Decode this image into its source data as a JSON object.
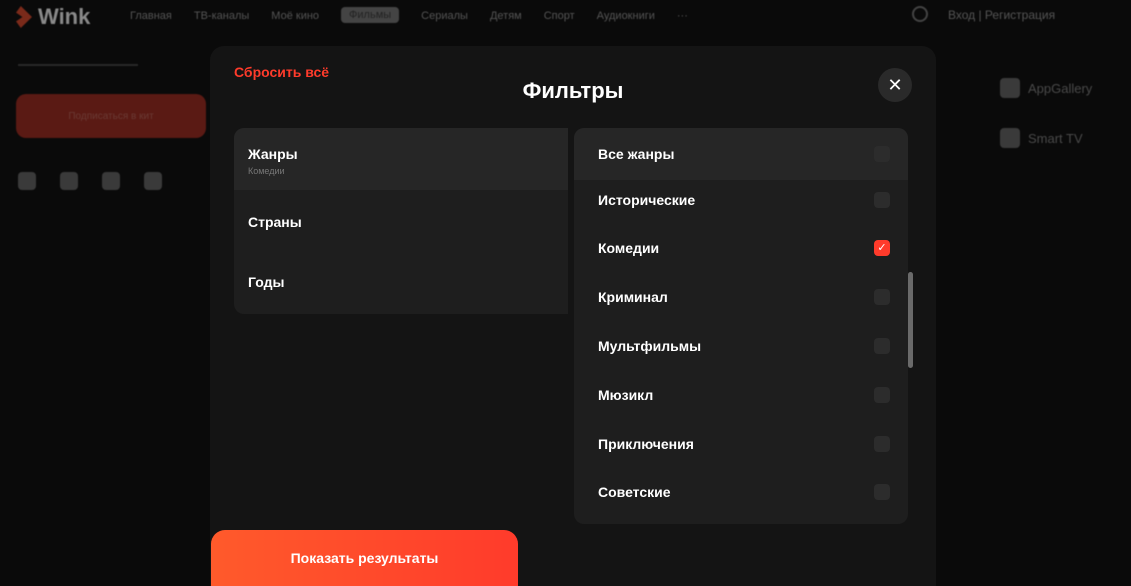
{
  "background": {
    "logo": "Wink",
    "nav": [
      "Главная",
      "ТВ-каналы",
      "Моё кино",
      "Фильмы",
      "Сериалы",
      "Детям",
      "Спорт",
      "Аудиокниги",
      "···"
    ],
    "login": "Вход | Регистрация",
    "left_button": "Подписаться в кит",
    "apps": [
      "AppGallery",
      "Smart TV"
    ]
  },
  "modal": {
    "reset_label": "Сбросить всё",
    "title": "Фильтры",
    "close_icon": "close-icon",
    "categories": [
      {
        "label": "Жанры",
        "sub": "Комедии"
      },
      {
        "label": "Страны"
      },
      {
        "label": "Годы"
      }
    ],
    "all_genres_label": "Все жанры",
    "genres": [
      {
        "label": "Исторические",
        "checked": false
      },
      {
        "label": "Комедии",
        "checked": true
      },
      {
        "label": "Криминал",
        "checked": false
      },
      {
        "label": "Мультфильмы",
        "checked": false
      },
      {
        "label": "Мюзикл",
        "checked": false
      },
      {
        "label": "Приключения",
        "checked": false
      },
      {
        "label": "Советские",
        "checked": false
      }
    ],
    "show_results_label": "Показать результаты",
    "accent_color": "#ff3b2b"
  }
}
